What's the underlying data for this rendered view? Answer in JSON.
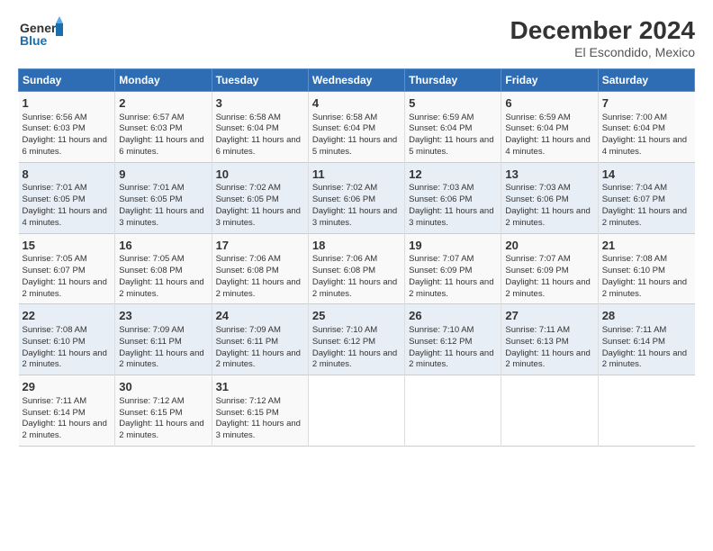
{
  "header": {
    "logo_line1": "General",
    "logo_line2": "Blue",
    "title": "December 2024",
    "subtitle": "El Escondido, Mexico"
  },
  "columns": [
    "Sunday",
    "Monday",
    "Tuesday",
    "Wednesday",
    "Thursday",
    "Friday",
    "Saturday"
  ],
  "weeks": [
    [
      {
        "day": "1",
        "rise": "6:56 AM",
        "set": "6:03 PM",
        "daylight": "11 hours and 6 minutes."
      },
      {
        "day": "2",
        "rise": "6:57 AM",
        "set": "6:03 PM",
        "daylight": "11 hours and 6 minutes."
      },
      {
        "day": "3",
        "rise": "6:58 AM",
        "set": "6:04 PM",
        "daylight": "11 hours and 6 minutes."
      },
      {
        "day": "4",
        "rise": "6:58 AM",
        "set": "6:04 PM",
        "daylight": "11 hours and 5 minutes."
      },
      {
        "day": "5",
        "rise": "6:59 AM",
        "set": "6:04 PM",
        "daylight": "11 hours and 5 minutes."
      },
      {
        "day": "6",
        "rise": "6:59 AM",
        "set": "6:04 PM",
        "daylight": "11 hours and 4 minutes."
      },
      {
        "day": "7",
        "rise": "7:00 AM",
        "set": "6:04 PM",
        "daylight": "11 hours and 4 minutes."
      }
    ],
    [
      {
        "day": "8",
        "rise": "7:01 AM",
        "set": "6:05 PM",
        "daylight": "11 hours and 4 minutes."
      },
      {
        "day": "9",
        "rise": "7:01 AM",
        "set": "6:05 PM",
        "daylight": "11 hours and 3 minutes."
      },
      {
        "day": "10",
        "rise": "7:02 AM",
        "set": "6:05 PM",
        "daylight": "11 hours and 3 minutes."
      },
      {
        "day": "11",
        "rise": "7:02 AM",
        "set": "6:06 PM",
        "daylight": "11 hours and 3 minutes."
      },
      {
        "day": "12",
        "rise": "7:03 AM",
        "set": "6:06 PM",
        "daylight": "11 hours and 3 minutes."
      },
      {
        "day": "13",
        "rise": "7:03 AM",
        "set": "6:06 PM",
        "daylight": "11 hours and 2 minutes."
      },
      {
        "day": "14",
        "rise": "7:04 AM",
        "set": "6:07 PM",
        "daylight": "11 hours and 2 minutes."
      }
    ],
    [
      {
        "day": "15",
        "rise": "7:05 AM",
        "set": "6:07 PM",
        "daylight": "11 hours and 2 minutes."
      },
      {
        "day": "16",
        "rise": "7:05 AM",
        "set": "6:08 PM",
        "daylight": "11 hours and 2 minutes."
      },
      {
        "day": "17",
        "rise": "7:06 AM",
        "set": "6:08 PM",
        "daylight": "11 hours and 2 minutes."
      },
      {
        "day": "18",
        "rise": "7:06 AM",
        "set": "6:08 PM",
        "daylight": "11 hours and 2 minutes."
      },
      {
        "day": "19",
        "rise": "7:07 AM",
        "set": "6:09 PM",
        "daylight": "11 hours and 2 minutes."
      },
      {
        "day": "20",
        "rise": "7:07 AM",
        "set": "6:09 PM",
        "daylight": "11 hours and 2 minutes."
      },
      {
        "day": "21",
        "rise": "7:08 AM",
        "set": "6:10 PM",
        "daylight": "11 hours and 2 minutes."
      }
    ],
    [
      {
        "day": "22",
        "rise": "7:08 AM",
        "set": "6:10 PM",
        "daylight": "11 hours and 2 minutes."
      },
      {
        "day": "23",
        "rise": "7:09 AM",
        "set": "6:11 PM",
        "daylight": "11 hours and 2 minutes."
      },
      {
        "day": "24",
        "rise": "7:09 AM",
        "set": "6:11 PM",
        "daylight": "11 hours and 2 minutes."
      },
      {
        "day": "25",
        "rise": "7:10 AM",
        "set": "6:12 PM",
        "daylight": "11 hours and 2 minutes."
      },
      {
        "day": "26",
        "rise": "7:10 AM",
        "set": "6:12 PM",
        "daylight": "11 hours and 2 minutes."
      },
      {
        "day": "27",
        "rise": "7:11 AM",
        "set": "6:13 PM",
        "daylight": "11 hours and 2 minutes."
      },
      {
        "day": "28",
        "rise": "7:11 AM",
        "set": "6:14 PM",
        "daylight": "11 hours and 2 minutes."
      }
    ],
    [
      {
        "day": "29",
        "rise": "7:11 AM",
        "set": "6:14 PM",
        "daylight": "11 hours and 2 minutes."
      },
      {
        "day": "30",
        "rise": "7:12 AM",
        "set": "6:15 PM",
        "daylight": "11 hours and 2 minutes."
      },
      {
        "day": "31",
        "rise": "7:12 AM",
        "set": "6:15 PM",
        "daylight": "11 hours and 3 minutes."
      },
      null,
      null,
      null,
      null
    ]
  ]
}
